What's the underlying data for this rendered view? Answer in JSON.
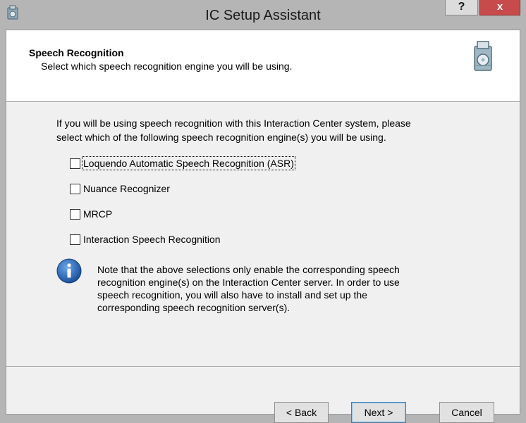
{
  "window": {
    "title": "IC Setup Assistant",
    "help_label": "?",
    "close_label": "x",
    "colors": {
      "close": "#c74b4b",
      "header_bg": "#ffffff",
      "client_bg": "#f0f0f0"
    }
  },
  "header": {
    "title": "Speech Recognition",
    "subtitle": "Select which speech recognition engine you will be using.",
    "icon": "setup-package-icon"
  },
  "body": {
    "intro_line1": "If you will be using speech recognition with this Interaction Center system, please",
    "intro_line2": "select which of the following speech recognition engine(s) you will be using."
  },
  "options": [
    {
      "label": "Loquendo Automatic Speech Recognition (ASR)",
      "checked": false
    },
    {
      "label": "Nuance Recognizer",
      "checked": false
    },
    {
      "label": "MRCP",
      "checked": false
    },
    {
      "label": "Interaction Speech Recognition",
      "checked": false
    }
  ],
  "note": {
    "icon": "info-icon",
    "line1": "Note that the above selections only enable the corresponding speech",
    "line2": "recognition engine(s) on the Interaction Center server. In order to use",
    "line3": "speech recognition, you will also have to install and set up the",
    "line4": "corresponding speech recognition server(s)."
  },
  "buttons": {
    "back": "< Back",
    "next": "Next >",
    "cancel": "Cancel"
  }
}
